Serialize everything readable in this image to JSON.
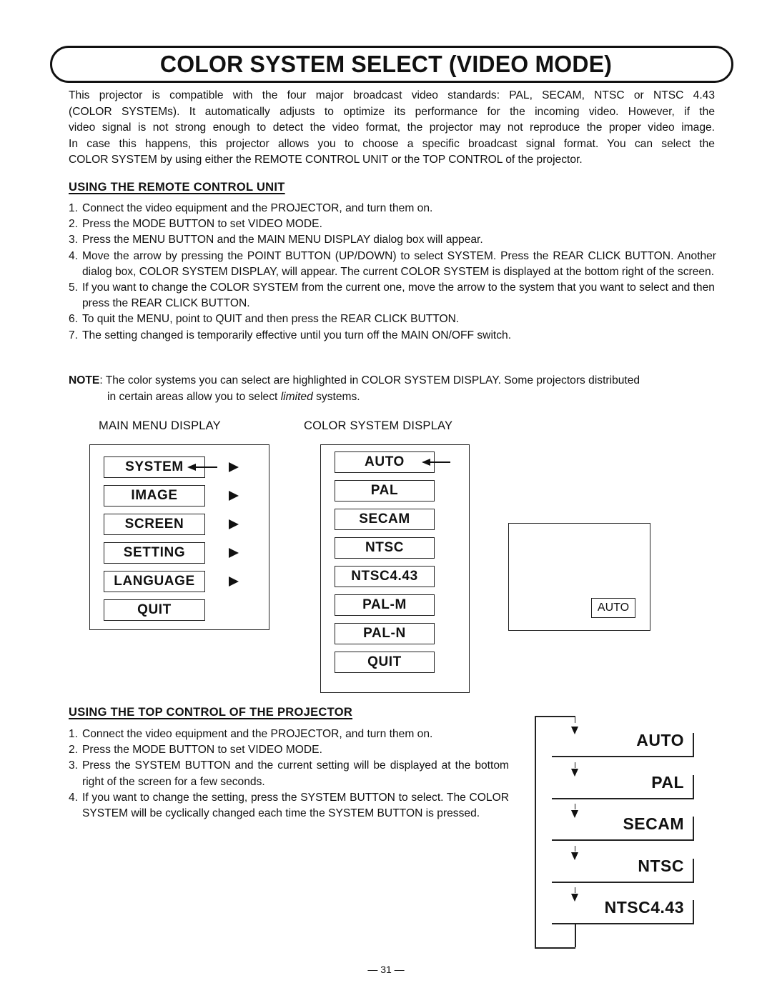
{
  "header": {
    "title": "COLOR SYSTEM SELECT (VIDEO MODE)"
  },
  "intro": {
    "lines": [
      "This projector is compatible with the four major broadcast video standards: PAL, SECAM, NTSC or NTSC 4.43",
      "(COLOR SYSTEMs). It automatically adjusts to optimize its performance for the incoming video. However, if the",
      "video signal is not strong enough to detect the video format, the projector may not reproduce the proper video image.",
      "In case this happens, this projector allows you to choose a specific broadcast signal format. You can select the",
      "COLOR SYSTEM by using either the REMOTE CONTROL UNIT or the TOP CONTROL of the projector."
    ]
  },
  "remote_section": {
    "heading": "USING THE REMOTE CONTROL UNIT",
    "steps": [
      {
        "num": "1.",
        "text": "Connect the video equipment and the PROJECTOR, and turn them on."
      },
      {
        "num": "2.",
        "text": "Press the MODE BUTTON to set VIDEO MODE."
      },
      {
        "num": "3.",
        "text": "Press the MENU BUTTON and the MAIN MENU DISPLAY dialog box will appear."
      },
      {
        "num": "4.",
        "text": "Move the arrow by pressing the POINT BUTTON (UP/DOWN) to select SYSTEM. Press the REAR CLICK BUTTON. Another dialog box, COLOR SYSTEM DISPLAY, will appear. The current COLOR SYSTEM is displayed at the bottom right of the screen."
      },
      {
        "num": "5.",
        "text": "If you want to change the COLOR SYSTEM from the current one, move the arrow to the system that you want to select and then press the REAR CLICK BUTTON."
      },
      {
        "num": "6.",
        "text": "To quit the MENU, point to QUIT and then press the REAR CLICK BUTTON."
      },
      {
        "num": "7.",
        "text": "The setting changed is temporarily effective until you turn off the MAIN ON/OFF switch."
      }
    ]
  },
  "note": {
    "label": "NOTE",
    "text_before": ": The color systems you can select are highlighted in COLOR SYSTEM DISPLAY. Some projectors distributed",
    "text_cont": "in certain areas allow you to select ",
    "emphasis": "limited",
    "text_after": " systems."
  },
  "main_menu_display": {
    "caption": "MAIN MENU DISPLAY",
    "items": [
      "SYSTEM",
      "IMAGE",
      "SCREEN",
      "SETTING",
      "LANGUAGE",
      "QUIT"
    ],
    "submenu_items": [
      "SYSTEM",
      "IMAGE",
      "SCREEN",
      "SETTING",
      "LANGUAGE"
    ],
    "selected": "SYSTEM"
  },
  "color_system_display": {
    "caption": "COLOR SYSTEM DISPLAY",
    "items": [
      "AUTO",
      "PAL",
      "SECAM",
      "NTSC",
      "NTSC4.43",
      "PAL-M",
      "PAL-N",
      "QUIT"
    ],
    "selected": "AUTO"
  },
  "screen_preview": {
    "badge": "AUTO"
  },
  "top_section": {
    "heading": "USING THE TOP CONTROL OF THE PROJECTOR",
    "steps": [
      {
        "num": "1.",
        "text": "Connect the video equipment and the PROJECTOR, and turn them on."
      },
      {
        "num": "2.",
        "text": "Press the MODE BUTTON to set VIDEO MODE."
      },
      {
        "num": "3.",
        "text": "Press the SYSTEM BUTTON and the current setting will be displayed at the bottom right of the screen for a few seconds."
      },
      {
        "num": "4.",
        "text": "If you want to change the setting, press the SYSTEM BUTTON to select. The COLOR SYSTEM will be cyclically changed each time the SYSTEM BUTTON is pressed."
      }
    ]
  },
  "cycle_diagram": {
    "items": [
      "AUTO",
      "PAL",
      "SECAM",
      "NTSC",
      "NTSC4.43"
    ]
  },
  "footer": {
    "page_number": "— 31 —"
  }
}
